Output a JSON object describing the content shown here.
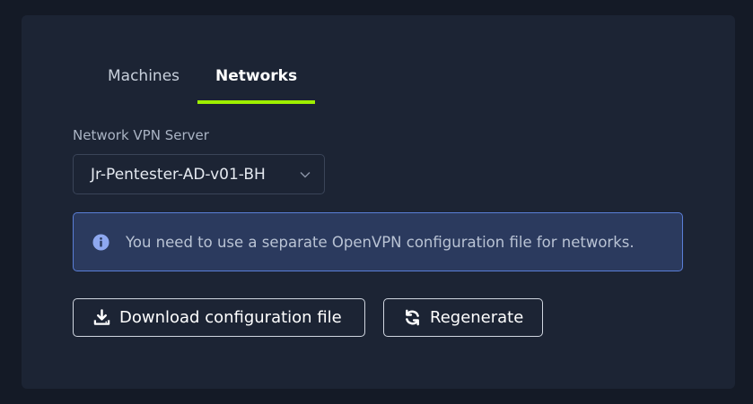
{
  "tabs": [
    {
      "label": "Machines",
      "active": false
    },
    {
      "label": "Networks",
      "active": true
    }
  ],
  "vpn": {
    "label": "Network VPN Server",
    "selected": "Jr-Pentester-AD-v01-BH"
  },
  "alert": {
    "icon": "info-circle-icon",
    "message": "You need to use a separate OpenVPN configuration file for networks."
  },
  "buttons": {
    "download": {
      "label": "Download configuration file",
      "icon": "download-icon"
    },
    "regenerate": {
      "label": "Regenerate",
      "icon": "refresh-icon"
    }
  },
  "colors": {
    "accent": "#9fef00",
    "background": "#141a26",
    "panel": "#1c2434",
    "alert_bg": "#2b3a5e",
    "alert_border": "#5a7ed6",
    "info": "#8ea8f0"
  }
}
